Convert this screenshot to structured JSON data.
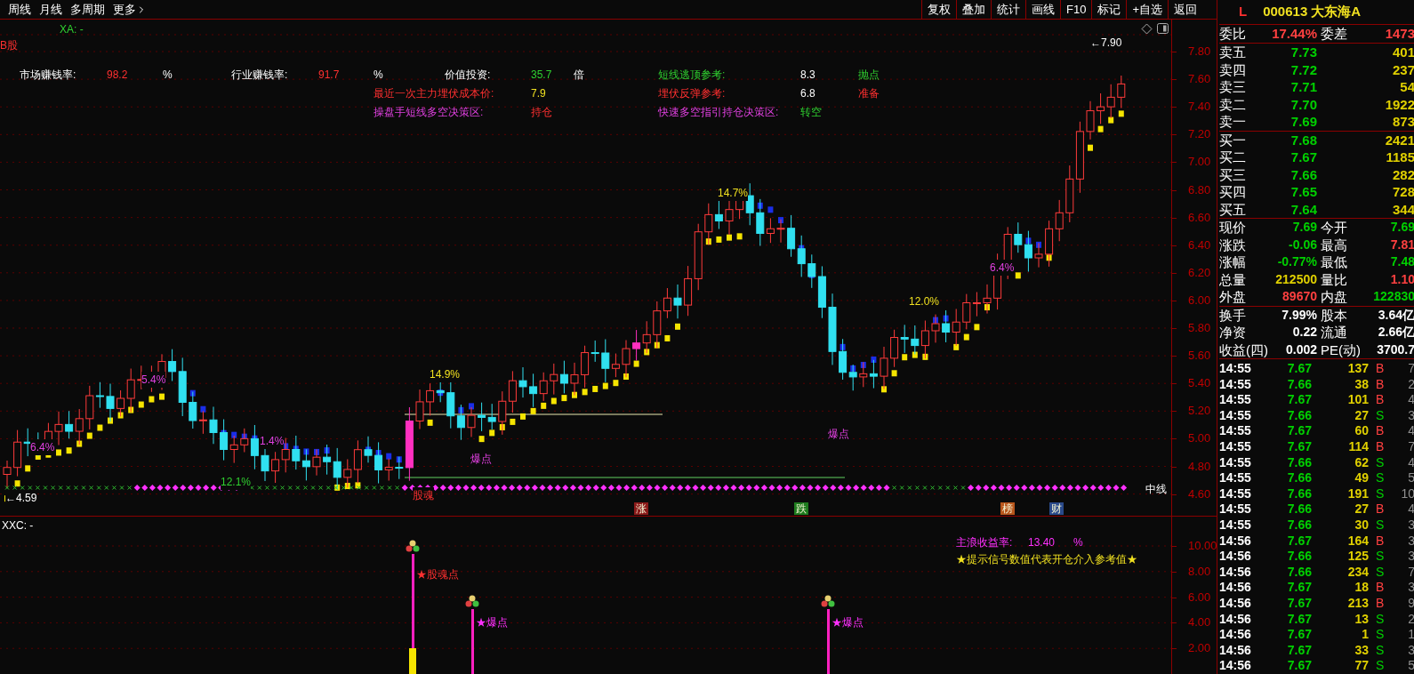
{
  "toolbar": {
    "left": [
      "周线",
      "月线",
      "多周期",
      "更多"
    ],
    "right": [
      "复权",
      "叠加",
      "统计",
      "画线",
      "F10",
      "标记",
      "+自选",
      "返回"
    ]
  },
  "main_chart": {
    "indicator_name": "XA: -",
    "corner_label": "B股",
    "stats": [
      {
        "label": "市场赚钱率:",
        "value": "98.2",
        "unit": "%"
      },
      {
        "label": "行业赚钱率:",
        "value": "91.7",
        "unit": "%"
      },
      {
        "label": "价值投资:",
        "value": "35.7",
        "unit": "倍"
      },
      {
        "label": "短线逃顶参考:",
        "value": "8.3",
        "unit": "抛点"
      },
      {
        "label": "最近一次主力埋伏成本价:",
        "value": "7.9"
      },
      {
        "label": "埋伏反弹参考:",
        "value": "6.8",
        "unit": "准备"
      },
      {
        "label": "操盘手短线多空决策区:",
        "value": "持仓"
      },
      {
        "label": "快速多空指引持仓决策区:",
        "value": "转空"
      }
    ],
    "annotations": [
      {
        "text": "6.4%",
        "kind": "pink"
      },
      {
        "text": "5.4%",
        "kind": "pink"
      },
      {
        "text": "1.4%",
        "kind": "pink"
      },
      {
        "text": "12.1%",
        "kind": "green"
      },
      {
        "text": "14.9%",
        "kind": "yellow"
      },
      {
        "text": "爆点",
        "kind": "pink"
      },
      {
        "text": "股魂",
        "kind": "red"
      },
      {
        "text": "14.7%",
        "kind": "yellow"
      },
      {
        "text": "爆点",
        "kind": "pink"
      },
      {
        "text": "12.0%",
        "kind": "yellow"
      },
      {
        "text": "6.4%",
        "kind": "pink"
      }
    ],
    "high_label": "←7.90",
    "low_label": "←4.59",
    "trend_label": "中线",
    "tags": [
      {
        "text": "涨",
        "color": "#8b1a1a"
      },
      {
        "text": "跌",
        "color": "#1e7b1e"
      },
      {
        "text": "榜",
        "color": "#b8561c"
      },
      {
        "text": "财",
        "color": "#2a4a8a"
      }
    ],
    "price_axis": [
      "7.80",
      "7.60",
      "7.40",
      "7.20",
      "7.00",
      "6.80",
      "6.60",
      "6.40",
      "6.20",
      "6.00",
      "5.80",
      "5.60",
      "5.40",
      "5.20",
      "5.00",
      "4.80",
      "4.60"
    ]
  },
  "sub_chart": {
    "indicator_name": "XXC: -",
    "return_label": "主浪收益率:",
    "return_value": "13.40",
    "return_unit": "%",
    "note": "★提示信号数值代表开仓介入参考值★",
    "signals": [
      {
        "text": "★股魂点",
        "kind": "soul"
      },
      {
        "text": "★爆点",
        "kind": "burst"
      },
      {
        "text": "★爆点",
        "kind": "burst"
      }
    ],
    "axis": [
      "10.00",
      "8.00",
      "6.00",
      "4.00",
      "2.00"
    ]
  },
  "quote": {
    "market": "L",
    "code": "000613",
    "name": "大东海A",
    "ratio": {
      "label": "委比",
      "value": "17.44%",
      "diff_label": "委差",
      "diff": "1473"
    },
    "asks": [
      {
        "label": "卖五",
        "price": "7.73",
        "volume": "401"
      },
      {
        "label": "卖四",
        "price": "7.72",
        "volume": "237"
      },
      {
        "label": "卖三",
        "price": "7.71",
        "volume": "54"
      },
      {
        "label": "卖二",
        "price": "7.70",
        "volume": "1922"
      },
      {
        "label": "卖一",
        "price": "7.69",
        "volume": "873"
      }
    ],
    "bids": [
      {
        "label": "买一",
        "price": "7.68",
        "volume": "2421"
      },
      {
        "label": "买二",
        "price": "7.67",
        "volume": "1185"
      },
      {
        "label": "买三",
        "price": "7.66",
        "volume": "282"
      },
      {
        "label": "买四",
        "price": "7.65",
        "volume": "728"
      },
      {
        "label": "买五",
        "price": "7.64",
        "volume": "344"
      }
    ],
    "fields": [
      {
        "label": "现价",
        "value": "7.69",
        "color": "#00d000"
      },
      {
        "label": "今开",
        "value": "7.69",
        "color": "#00d000"
      },
      {
        "label": "涨跌",
        "value": "-0.06",
        "color": "#00d000"
      },
      {
        "label": "最高",
        "value": "7.81",
        "color": "#ff4040"
      },
      {
        "label": "涨幅",
        "value": "-0.77%",
        "color": "#00d000"
      },
      {
        "label": "最低",
        "value": "7.48",
        "color": "#00d000"
      },
      {
        "label": "总量",
        "value": "212500",
        "color": "#e0d000"
      },
      {
        "label": "量比",
        "value": "1.10",
        "color": "#ff4040"
      },
      {
        "label": "外盘",
        "value": "89670",
        "color": "#ff4040"
      },
      {
        "label": "内盘",
        "value": "122830",
        "color": "#00d000"
      }
    ],
    "fundamentals": [
      {
        "label": "换手",
        "value": "7.99%"
      },
      {
        "label": "股本",
        "value": "3.64亿"
      },
      {
        "label": "净资",
        "value": "0.22"
      },
      {
        "label": "流通",
        "value": "2.66亿"
      },
      {
        "label": "收益(四)",
        "value": "0.002"
      },
      {
        "label": "PE(动)",
        "value": "3700.7"
      }
    ],
    "ticks": [
      {
        "time": "14:55",
        "price": "7.67",
        "volume": "137",
        "side": "B",
        "kind": "buy",
        "count": "7"
      },
      {
        "time": "14:55",
        "price": "7.66",
        "volume": "38",
        "side": "B",
        "kind": "buy",
        "count": "2"
      },
      {
        "time": "14:55",
        "price": "7.67",
        "volume": "101",
        "side": "B",
        "kind": "buy",
        "count": "4"
      },
      {
        "time": "14:55",
        "price": "7.66",
        "volume": "27",
        "side": "S",
        "kind": "sell",
        "count": "3"
      },
      {
        "time": "14:55",
        "price": "7.67",
        "volume": "60",
        "side": "B",
        "kind": "buy",
        "count": "4"
      },
      {
        "time": "14:55",
        "price": "7.67",
        "volume": "114",
        "side": "B",
        "kind": "buy",
        "count": "7"
      },
      {
        "time": "14:55",
        "price": "7.66",
        "volume": "62",
        "side": "S",
        "kind": "sell",
        "count": "4"
      },
      {
        "time": "14:55",
        "price": "7.66",
        "volume": "49",
        "side": "S",
        "kind": "sell",
        "count": "5"
      },
      {
        "time": "14:55",
        "price": "7.66",
        "volume": "191",
        "side": "S",
        "kind": "sell",
        "count": "10"
      },
      {
        "time": "14:55",
        "price": "7.66",
        "volume": "27",
        "side": "B",
        "kind": "buy",
        "count": "4"
      },
      {
        "time": "14:55",
        "price": "7.66",
        "volume": "30",
        "side": "S",
        "kind": "sell",
        "count": "3"
      },
      {
        "time": "14:56",
        "price": "7.67",
        "volume": "164",
        "side": "B",
        "kind": "buy",
        "count": "3"
      },
      {
        "time": "14:56",
        "price": "7.66",
        "volume": "125",
        "side": "S",
        "kind": "sell",
        "count": "3"
      },
      {
        "time": "14:56",
        "price": "7.66",
        "volume": "234",
        "side": "S",
        "kind": "sell",
        "count": "7"
      },
      {
        "time": "14:56",
        "price": "7.67",
        "volume": "18",
        "side": "B",
        "kind": "buy",
        "count": "3"
      },
      {
        "time": "14:56",
        "price": "7.67",
        "volume": "213",
        "side": "B",
        "kind": "buy",
        "count": "9"
      },
      {
        "time": "14:56",
        "price": "7.67",
        "volume": "13",
        "side": "S",
        "kind": "sell",
        "count": "2"
      },
      {
        "time": "14:56",
        "price": "7.67",
        "volume": "1",
        "side": "S",
        "kind": "sell",
        "count": "1"
      },
      {
        "time": "14:56",
        "price": "7.67",
        "volume": "33",
        "side": "S",
        "kind": "sell",
        "count": "3"
      },
      {
        "time": "14:56",
        "price": "7.67",
        "volume": "77",
        "side": "S",
        "kind": "sell",
        "count": "5"
      }
    ]
  }
}
